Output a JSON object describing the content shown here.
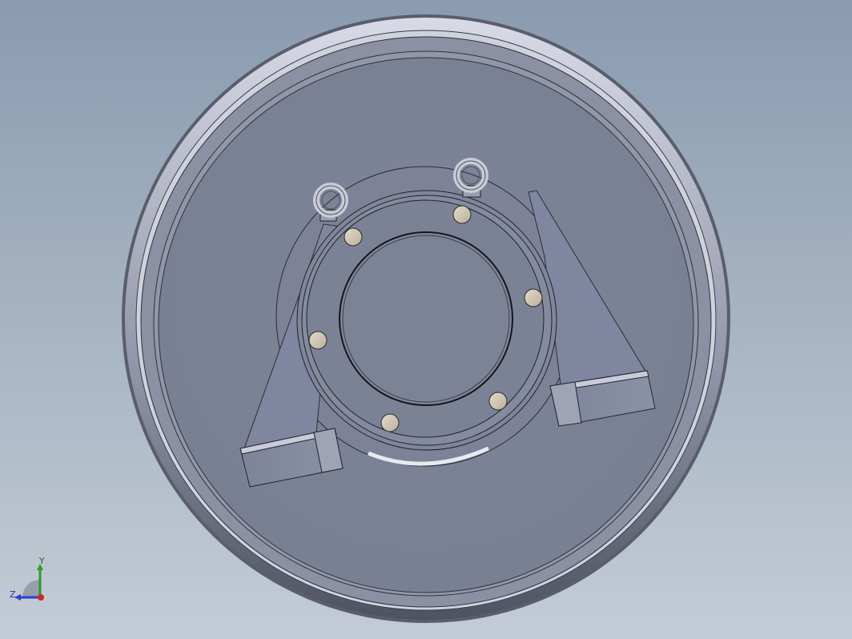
{
  "viewport": {
    "background_top": "#8a9bb0",
    "background_bottom": "#c3ccd6"
  },
  "model": {
    "description_icon": "pillow-block-bearing-on-disc",
    "bolt_count": 6,
    "eyebolt_count": 2
  },
  "triad": {
    "x_color": "#d0262a",
    "y_color": "#2c9a2c",
    "z_color": "#2a3fd0",
    "y_label": "Y",
    "z_label": "Z"
  }
}
